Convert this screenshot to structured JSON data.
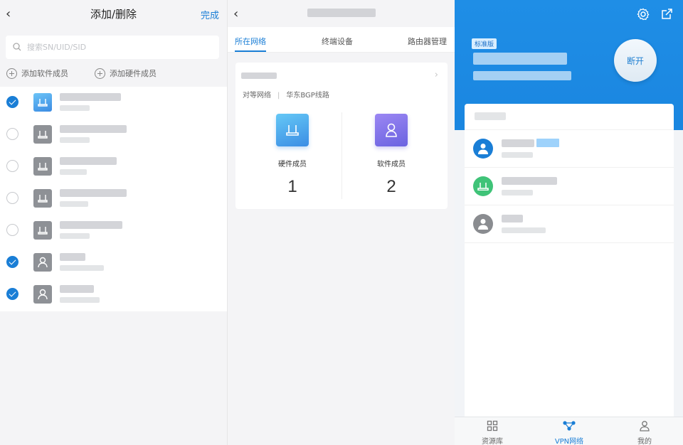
{
  "screen1": {
    "title": "添加/删除",
    "done": "完成",
    "search_placeholder": "搜索SN/UID/SID",
    "add_software": "添加软件成员",
    "add_hardware": "添加硬件成员",
    "items": [
      {
        "checked": true,
        "icon": "router-icon",
        "icon_color": "blue"
      },
      {
        "checked": false,
        "icon": "router-icon",
        "icon_color": "gray"
      },
      {
        "checked": false,
        "icon": "router-icon",
        "icon_color": "gray"
      },
      {
        "checked": false,
        "icon": "router-icon",
        "icon_color": "gray"
      },
      {
        "checked": false,
        "icon": "router-icon",
        "icon_color": "gray"
      },
      {
        "checked": true,
        "icon": "user-icon",
        "icon_color": "gray"
      },
      {
        "checked": true,
        "icon": "user-icon",
        "icon_color": "gray"
      }
    ]
  },
  "screen2": {
    "tabs": [
      "所在网络",
      "终端设备",
      "路由器管理"
    ],
    "active_tab": "所在网络",
    "network_type": "对等网络",
    "separator": "|",
    "line": "华东BGP线路",
    "hardware_label": "硬件成员",
    "hardware_count": "1",
    "software_label": "软件成员",
    "software_count": "2"
  },
  "screen3": {
    "badge": "标准版",
    "disconnect": "断开",
    "nav": [
      {
        "label": "资源库",
        "icon": "grid-icon"
      },
      {
        "label": "VPN网络",
        "icon": "network-icon"
      },
      {
        "label": "我的",
        "icon": "profile-icon"
      }
    ],
    "active_nav": "VPN网络",
    "members": [
      {
        "avatar": "user-icon",
        "color": "#1a7ed6"
      },
      {
        "avatar": "router-icon",
        "color": "#3fc378"
      },
      {
        "avatar": "user-icon",
        "color": "#8a8c90"
      }
    ]
  },
  "colors": {
    "accent": "#1a7ed6",
    "header_blue": "#1f8ee6",
    "green": "#3fc378"
  }
}
